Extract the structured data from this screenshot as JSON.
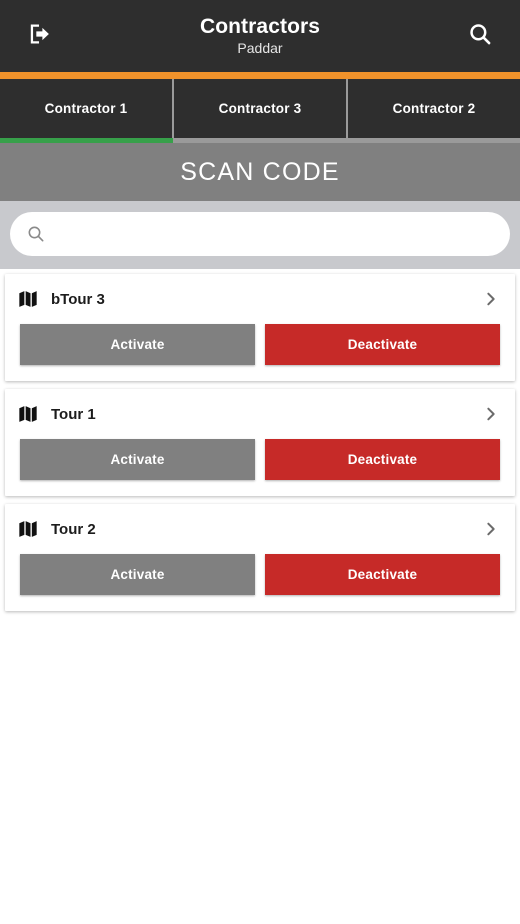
{
  "colors": {
    "appbar_bg": "#2e2e2e",
    "accent_orange": "#f0922b",
    "tab_indicator_green": "#37a04a",
    "scan_banner_bg": "#808080",
    "search_strip_bg": "#c8c9cd",
    "activate_grey": "#808080",
    "deactivate_red": "#c62a28",
    "page_bg": "#ffffff"
  },
  "appbar": {
    "logout_icon": "sign-out-icon",
    "title": "Contractors",
    "subtitle": "Paddar",
    "search_icon": "search-icon"
  },
  "tabs": {
    "active_index": 0,
    "items": [
      {
        "label": "Contractor 1"
      },
      {
        "label": "Contractor 3"
      },
      {
        "label": "Contractor 2"
      }
    ]
  },
  "scan_banner": {
    "label": "SCAN CODE"
  },
  "search": {
    "icon": "search-icon",
    "value": "",
    "placeholder": ""
  },
  "list": {
    "row_icon": "map-icon",
    "chevron_icon": "chevron-right-icon",
    "activate_label": "Activate",
    "deactivate_label": "Deactivate",
    "items": [
      {
        "title": "bTour 3",
        "activate": "Activate",
        "deactivate": "Deactivate"
      },
      {
        "title": "Tour 1",
        "activate": "Activate",
        "deactivate": "Deactivate"
      },
      {
        "title": "Tour 2",
        "activate": "Activate",
        "deactivate": "Deactivate"
      }
    ]
  }
}
